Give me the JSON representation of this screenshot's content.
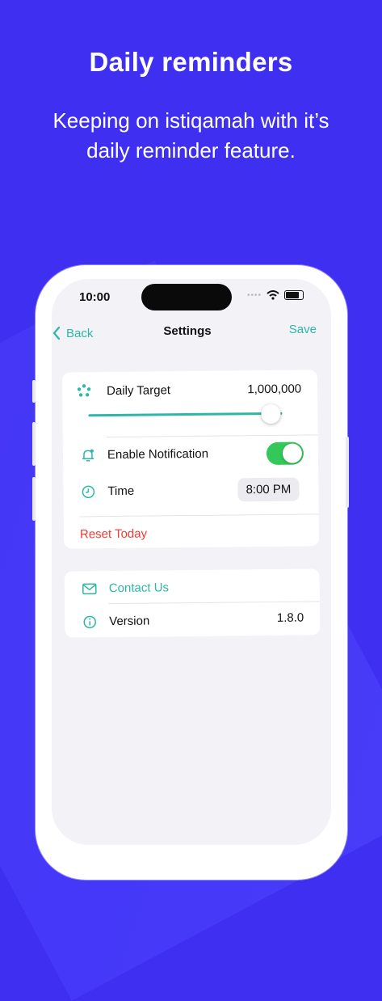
{
  "promo": {
    "headline": "Daily reminders",
    "subline": "Keeping on istiqamah with it’s daily reminder feature."
  },
  "status_bar": {
    "time": "10:00"
  },
  "nav": {
    "back_label": "Back",
    "title": "Settings",
    "save_label": "Save"
  },
  "settings": {
    "daily_target_label": "Daily Target",
    "daily_target_value": "1,000,000",
    "slider_fraction": 0.94,
    "notification_label": "Enable Notification",
    "notification_enabled": true,
    "time_label": "Time",
    "time_value": "8:00 PM",
    "reset_label": "Reset Today"
  },
  "about": {
    "contact_label": "Contact Us",
    "version_label": "Version",
    "version_value": "1.8.0"
  },
  "colors": {
    "background": "#3f2ff0",
    "accent": "#2db7a6",
    "toggle_on": "#34c759",
    "destructive": "#ef3b32"
  }
}
